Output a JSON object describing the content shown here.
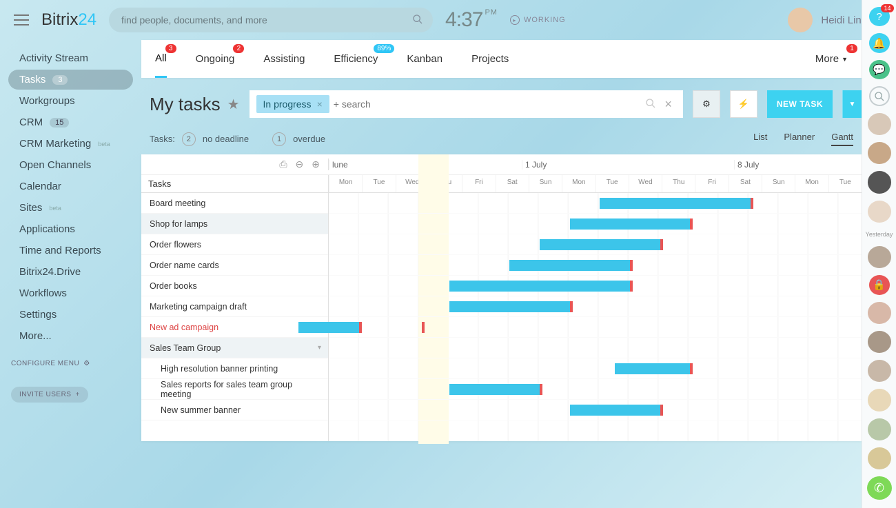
{
  "header": {
    "logo_a": "Bitrix",
    "logo_b": "24",
    "search_placeholder": "find people, documents, and more",
    "clock_time": "4:37",
    "clock_ampm": "PM",
    "working_label": "WORKING",
    "user_name": "Heidi Ling"
  },
  "sidebar": {
    "items": [
      {
        "label": "Activity Stream"
      },
      {
        "label": "Tasks",
        "count": "3",
        "active": true
      },
      {
        "label": "Workgroups"
      },
      {
        "label": "CRM",
        "count": "15"
      },
      {
        "label": "CRM Marketing",
        "beta": "beta"
      },
      {
        "label": "Open Channels"
      },
      {
        "label": "Calendar"
      },
      {
        "label": "Sites",
        "beta": "beta"
      },
      {
        "label": "Applications"
      },
      {
        "label": "Time and Reports"
      },
      {
        "label": "Bitrix24.Drive"
      },
      {
        "label": "Workflows"
      },
      {
        "label": "Settings"
      },
      {
        "label": "More..."
      }
    ],
    "configure_label": "CONFIGURE MENU",
    "invite_label": "INVITE USERS"
  },
  "tabs": [
    {
      "label": "All",
      "badge": "3",
      "active": true
    },
    {
      "label": "Ongoing",
      "badge": "2"
    },
    {
      "label": "Assisting"
    },
    {
      "label": "Efficiency",
      "badge": "89%",
      "blue": true
    },
    {
      "label": "Kanban"
    },
    {
      "label": "Projects"
    }
  ],
  "tabs_more": {
    "label": "More",
    "badge": "1"
  },
  "page": {
    "title": "My tasks",
    "filter_chip": "In progress",
    "filter_placeholder": "+ search",
    "new_task_label": "NEW TASK"
  },
  "stats": {
    "prefix": "Tasks:",
    "no_deadline_count": "2",
    "no_deadline_label": "no deadline",
    "overdue_count": "1",
    "overdue_label": "overdue"
  },
  "views": {
    "list": "List",
    "planner": "Planner",
    "gantt": "Gantt"
  },
  "gantt": {
    "tasks_head": "Tasks",
    "months": [
      "lune",
      "1 July",
      "8 July"
    ],
    "days": [
      "Mon",
      "Tue",
      "Wed",
      "Thu",
      "Fri",
      "Sat",
      "Sun",
      "Mon",
      "Tue",
      "Wed",
      "Thu",
      "Fri",
      "Sat",
      "Sun",
      "Mon",
      "Tue"
    ],
    "tasks": [
      {
        "label": "Board meeting"
      },
      {
        "label": "Shop for lamps",
        "highlighted": true
      },
      {
        "label": "Order flowers"
      },
      {
        "label": "Order name cards"
      },
      {
        "label": "Order books"
      },
      {
        "label": "Marketing campaign draft"
      },
      {
        "label": "New ad campaign",
        "red": true
      },
      {
        "label": "Sales Team Group",
        "group": true,
        "highlighted": true
      },
      {
        "label": "High resolution banner printing",
        "sub": true
      },
      {
        "label": "Sales reports for sales team group meeting",
        "sub": true
      },
      {
        "label": "New summer banner",
        "sub": true
      }
    ]
  },
  "rail": {
    "help_badge": "14",
    "yesterday_label": "Yesterday"
  },
  "chart_data": {
    "type": "gantt",
    "x_unit": "day_index_monday=0",
    "tasks": [
      {
        "name": "Board meeting",
        "start": 9,
        "end": 14
      },
      {
        "name": "Shop for lamps",
        "start": 8,
        "end": 12
      },
      {
        "name": "Order flowers",
        "start": 7,
        "end": 11
      },
      {
        "name": "Order name cards",
        "start": 6,
        "end": 10
      },
      {
        "name": "Order books",
        "start": 4,
        "end": 10
      },
      {
        "name": "Marketing campaign draft",
        "start": 4,
        "end": 8
      },
      {
        "name": "New ad campaign",
        "start": -1,
        "end": 1,
        "deadline_at": 3.1
      },
      {
        "name": "Sales Team Group"
      },
      {
        "name": "High resolution banner printing",
        "start": 9.5,
        "end": 12
      },
      {
        "name": "Sales reports for sales team group meeting",
        "start": 4,
        "end": 7
      },
      {
        "name": "New summer banner",
        "start": 8,
        "end": 11
      }
    ],
    "dependencies": [
      [
        "New ad campaign",
        "Marketing campaign draft"
      ],
      [
        "Order books",
        "Order name cards"
      ],
      [
        "Order name cards",
        "Order flowers"
      ],
      [
        "Order flowers",
        "Shop for lamps"
      ],
      [
        "Shop for lamps",
        "Board meeting"
      ],
      [
        "Sales reports for sales team group meeting",
        "New summer banner"
      ],
      [
        "New summer banner",
        "High resolution banner printing"
      ]
    ]
  }
}
